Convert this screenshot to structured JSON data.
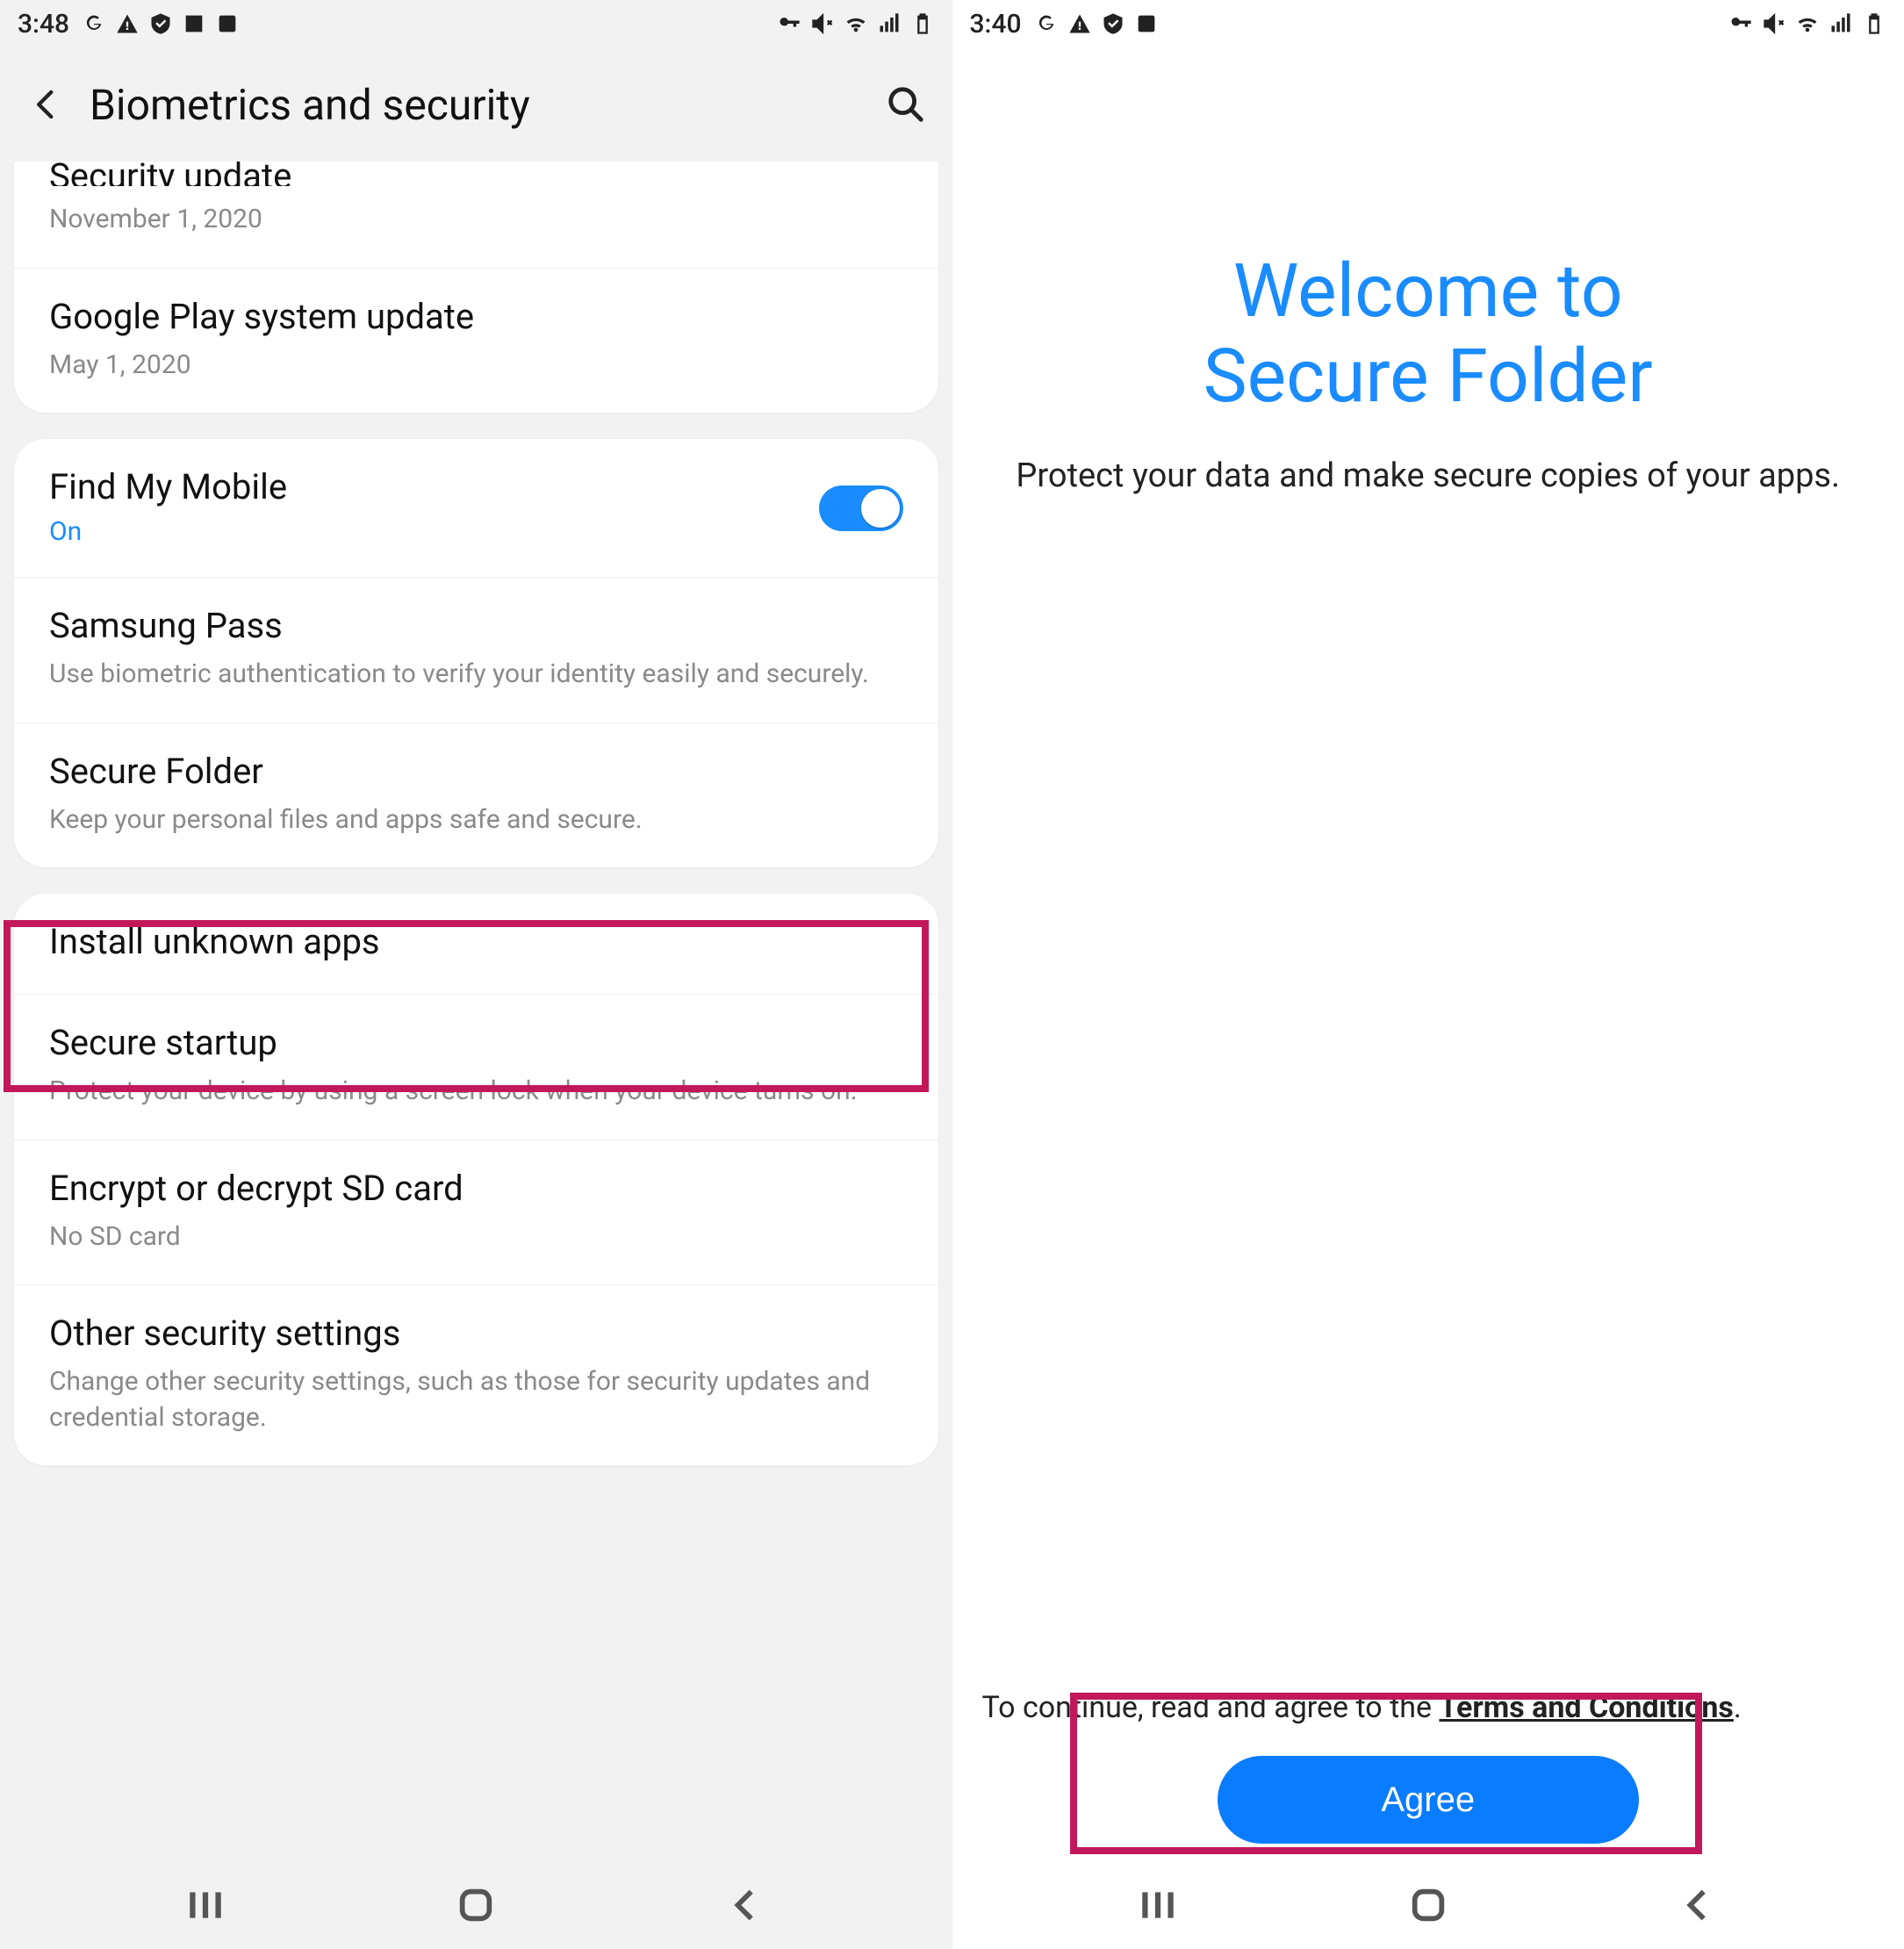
{
  "left": {
    "status": {
      "time": "3:48"
    },
    "appbar": {
      "title": "Biometrics and security"
    },
    "group1": {
      "item0": {
        "title": "Security update",
        "sub": "November 1, 2020"
      },
      "item1": {
        "title": "Google Play system update",
        "sub": "May 1, 2020"
      }
    },
    "group2": {
      "item0": {
        "title": "Find My Mobile",
        "status": "On"
      },
      "item1": {
        "title": "Samsung Pass",
        "sub": "Use biometric authentication to verify your identity easily and securely."
      },
      "item2": {
        "title": "Secure Folder",
        "sub": "Keep your personal files and apps safe and secure."
      }
    },
    "group3": {
      "item0": {
        "title": "Install unknown apps"
      },
      "item1": {
        "title": "Secure startup",
        "sub": "Protect your device by using a screen lock when your device turns on."
      },
      "item2": {
        "title": "Encrypt or decrypt SD card",
        "sub": "No SD card"
      },
      "item3": {
        "title": "Other security settings",
        "sub": "Change other security settings, such as those for security updates and credential storage."
      }
    }
  },
  "right": {
    "status": {
      "time": "3:40"
    },
    "welcome": {
      "title_line1": "Welcome to",
      "title_line2": "Secure Folder",
      "sub": "Protect your data and make secure copies of your apps."
    },
    "tc": {
      "prefix": "To continue, read and agree to the ",
      "link": "Terms and Conditions",
      "suffix": "."
    },
    "agree_label": "Agree"
  }
}
